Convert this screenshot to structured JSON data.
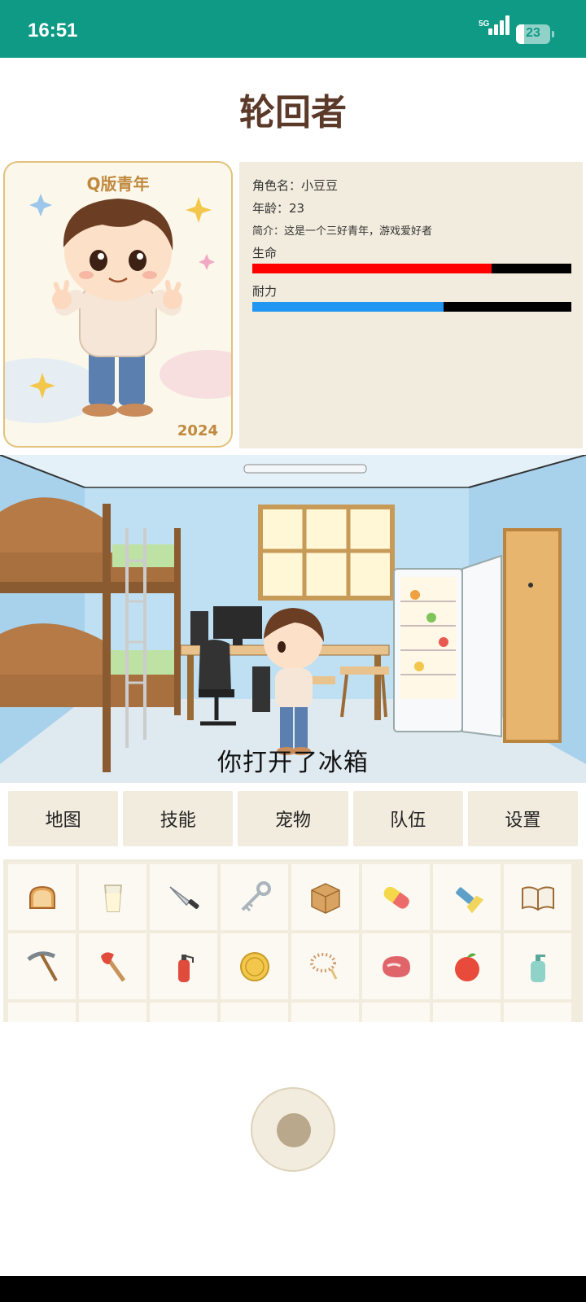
{
  "status_bar": {
    "time": "16:51",
    "network": "5G",
    "battery": "23",
    "battery_level": 0.23,
    "background_color": "#0e9a85"
  },
  "title": "轮回者",
  "avatar_card": {
    "caption": "Q版青年",
    "year": "2024"
  },
  "character": {
    "name_label": "角色名：小豆豆",
    "age_label": "年龄：23",
    "intro_label": "简介：这是一个三好青年，游戏爱好者",
    "hp_label": "生命",
    "hp_level": 0.75,
    "hp_color": "#ff0000",
    "stamina_label": "耐力",
    "stamina_level": 0.6,
    "stamina_color": "#2196f3"
  },
  "scene": {
    "message": "你打开了冰箱"
  },
  "menu": {
    "items": [
      "地图",
      "技能",
      "宠物",
      "队伍",
      "设置"
    ]
  },
  "inventory": {
    "items": [
      {
        "icon": "bread-icon"
      },
      {
        "icon": "milk-glass-icon"
      },
      {
        "icon": "knife-icon"
      },
      {
        "icon": "key-icon"
      },
      {
        "icon": "box-icon"
      },
      {
        "icon": "pill-icon"
      },
      {
        "icon": "flashlight-icon"
      },
      {
        "icon": "book-icon"
      },
      {
        "icon": "pickaxe-icon"
      },
      {
        "icon": "axe-icon"
      },
      {
        "icon": "fire-extinguisher-icon"
      },
      {
        "icon": "coin-icon"
      },
      {
        "icon": "beads-icon"
      },
      {
        "icon": "meat-icon"
      },
      {
        "icon": "apple-icon"
      },
      {
        "icon": "soap-bottle-icon"
      }
    ]
  }
}
